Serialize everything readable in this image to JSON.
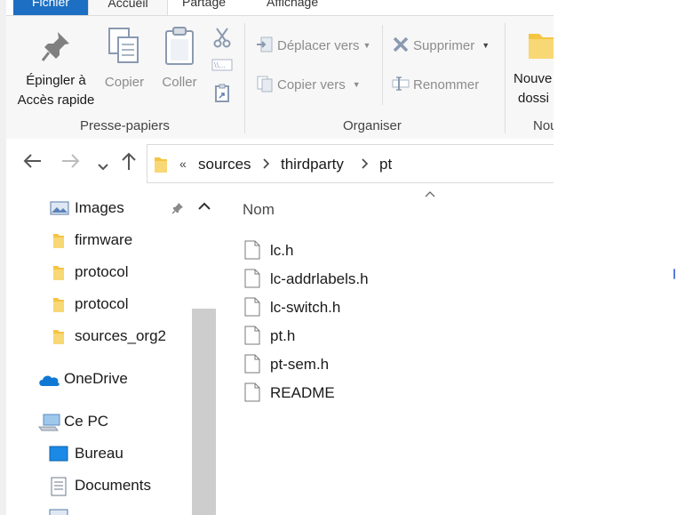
{
  "ribbon": {
    "tabs": [
      "Fichier",
      "Accueil",
      "Partage",
      "Affichage"
    ],
    "clipboard": {
      "pin_label_1": "Épingler à",
      "pin_label_2": "Accès rapide",
      "copy_label": "Copier",
      "paste_label": "Coller",
      "group_label": "Presse-papiers"
    },
    "organize": {
      "move_label": "Déplacer vers",
      "copyto_label": "Copier vers",
      "delete_label": "Supprimer",
      "rename_label": "Renommer",
      "group_label": "Organiser"
    },
    "new": {
      "newfolder_label_1": "Nouve",
      "newfolder_label_2": "dossi",
      "group_label": "Nou"
    }
  },
  "address": {
    "overflow": "«",
    "crumbs": [
      "sources",
      "thirdparty",
      "pt"
    ]
  },
  "navpane": {
    "items": [
      {
        "label": "Images"
      },
      {
        "label": "firmware"
      },
      {
        "label": "protocol"
      },
      {
        "label": "protocol"
      },
      {
        "label": "sources_org2"
      },
      {
        "label": "OneDrive"
      },
      {
        "label": "Ce PC"
      },
      {
        "label": "Bureau"
      },
      {
        "label": "Documents"
      }
    ]
  },
  "content": {
    "column_header": "Nom",
    "files": [
      "lc.h",
      "lc-addrlabels.h",
      "lc-switch.h",
      "pt.h",
      "pt-sem.h",
      "README"
    ]
  },
  "colors": {
    "accent": "#1c6fc2",
    "folder": "#f4c542",
    "onedrive": "#0f78d4"
  }
}
